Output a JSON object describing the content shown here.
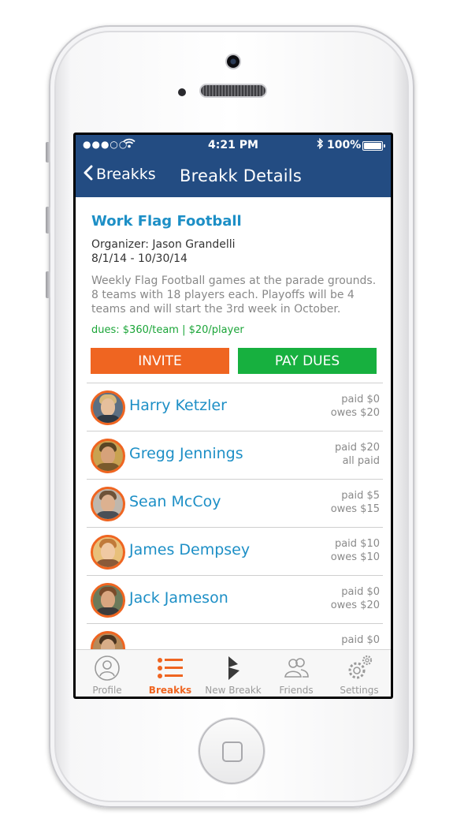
{
  "status_bar": {
    "signal": "●●●○○",
    "time": "4:21 PM",
    "battery": "100%"
  },
  "nav": {
    "back_label": "Breakks",
    "title": "Breakk Details"
  },
  "event": {
    "title": "Work Flag Football",
    "organizer": "Organizer: Jason Grandelli",
    "dates": "8/1/14 - 10/30/14",
    "description": "Weekly Flag Football games at the parade grounds. 8 teams with 18 players each. Playoffs will be 4 teams and will start the 3rd week in October.",
    "dues": "dues: $360/team | $20/player"
  },
  "actions": {
    "invite_label": "INVITE",
    "pay_label": "PAY DUES"
  },
  "members": [
    {
      "name": "Harry Ketzler",
      "paid": "paid $0",
      "owes": "owes $20"
    },
    {
      "name": "Gregg Jennings",
      "paid": "paid $20",
      "owes": "all paid"
    },
    {
      "name": "Sean McCoy",
      "paid": "paid $5",
      "owes": "owes $15"
    },
    {
      "name": "James Dempsey",
      "paid": "paid $10",
      "owes": "owes $10"
    },
    {
      "name": "Jack Jameson",
      "paid": "paid $0",
      "owes": "owes $20"
    },
    {
      "name": "",
      "paid": "paid $0",
      "owes": ""
    }
  ],
  "tabs": [
    {
      "label": "Profile",
      "icon": "profile-icon"
    },
    {
      "label": "Breakks",
      "icon": "list-icon",
      "active": true
    },
    {
      "label": "New Breakk",
      "icon": "new-breakk-icon"
    },
    {
      "label": "Friends",
      "icon": "friends-icon"
    },
    {
      "label": "Settings",
      "icon": "settings-icon"
    }
  ],
  "colors": {
    "header": "#234c82",
    "accent_orange": "#ef6521",
    "accent_green": "#17b03f",
    "link_blue": "#1d8fc6"
  }
}
